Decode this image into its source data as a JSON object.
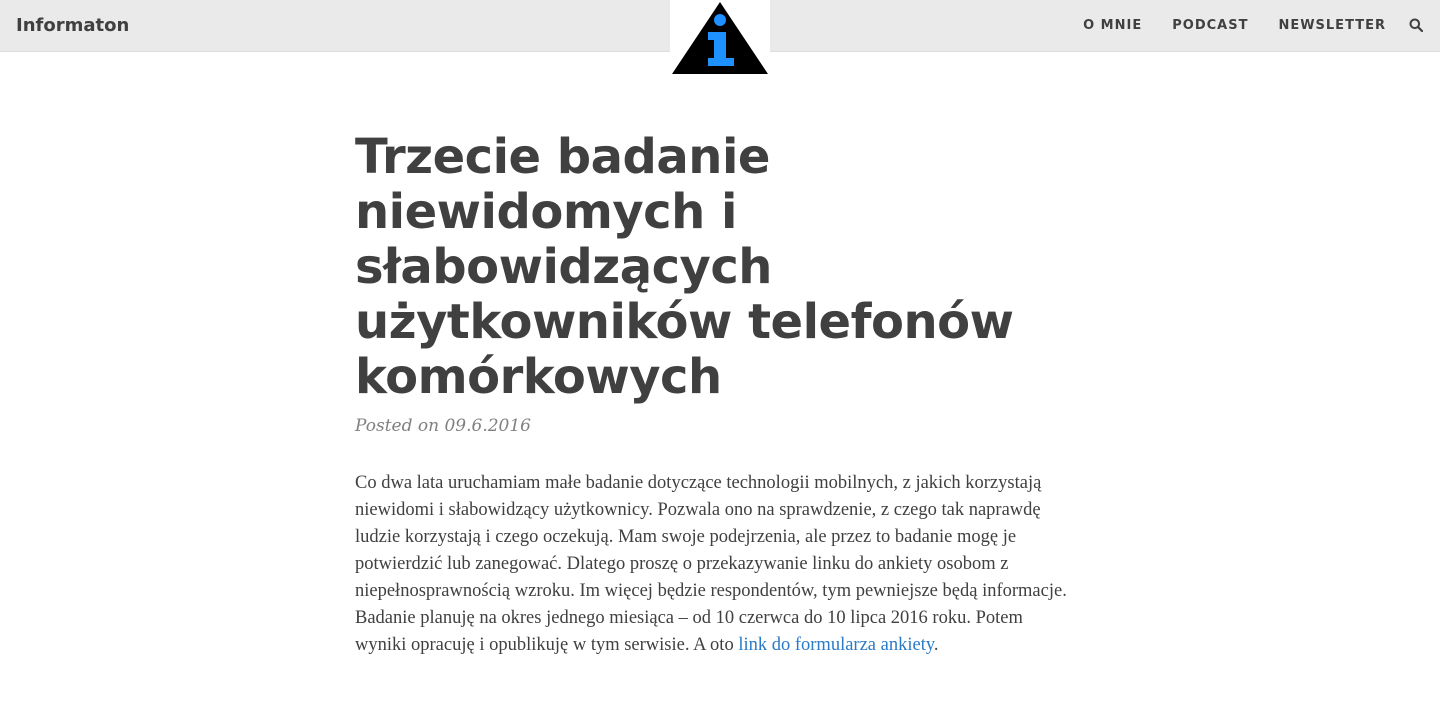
{
  "header": {
    "brand": "Informaton",
    "nav": [
      {
        "label": "O MNIE"
      },
      {
        "label": "PODCAST"
      },
      {
        "label": "NEWSLETTER"
      }
    ]
  },
  "colors": {
    "navbar_bg": "#eaeaea",
    "text": "#404040",
    "meta": "#808080",
    "link": "#2a7ac8",
    "logo_triangle": "#000000",
    "logo_letter": "#1e90ff"
  },
  "icons": {
    "logo": "info-triangle-icon",
    "search": "search-icon"
  },
  "post": {
    "title": "Trzecie badanie niewidomych i słabowidzących użytkowników telefonów komórkowych",
    "meta": "Posted on 09.6.2016",
    "body_text": "Co dwa lata uruchamiam małe badanie dotyczące technologii mobilnych, z jakich korzystają niewidomi i słabowidzący użytkownicy. Pozwala ono na sprawdzenie, z czego tak naprawdę ludzie korzystają i czego oczekują. Mam swoje podejrzenia, ale przez to badanie mogę je potwierdzić lub zanegować. Dlatego proszę o przekazywanie linku do ankiety osobom z niepełnosprawnością wzroku. Im więcej będzie respondentów, tym pewniejsze będą informacje. Badanie planuję na okres jednego miesiąca – od 10 czerwca do 10 lipca 2016 roku. Potem wyniki opracuję i opublikuję w tym serwisie. A oto ",
    "link_text": "link do formularza ankiety",
    "body_end": "."
  }
}
